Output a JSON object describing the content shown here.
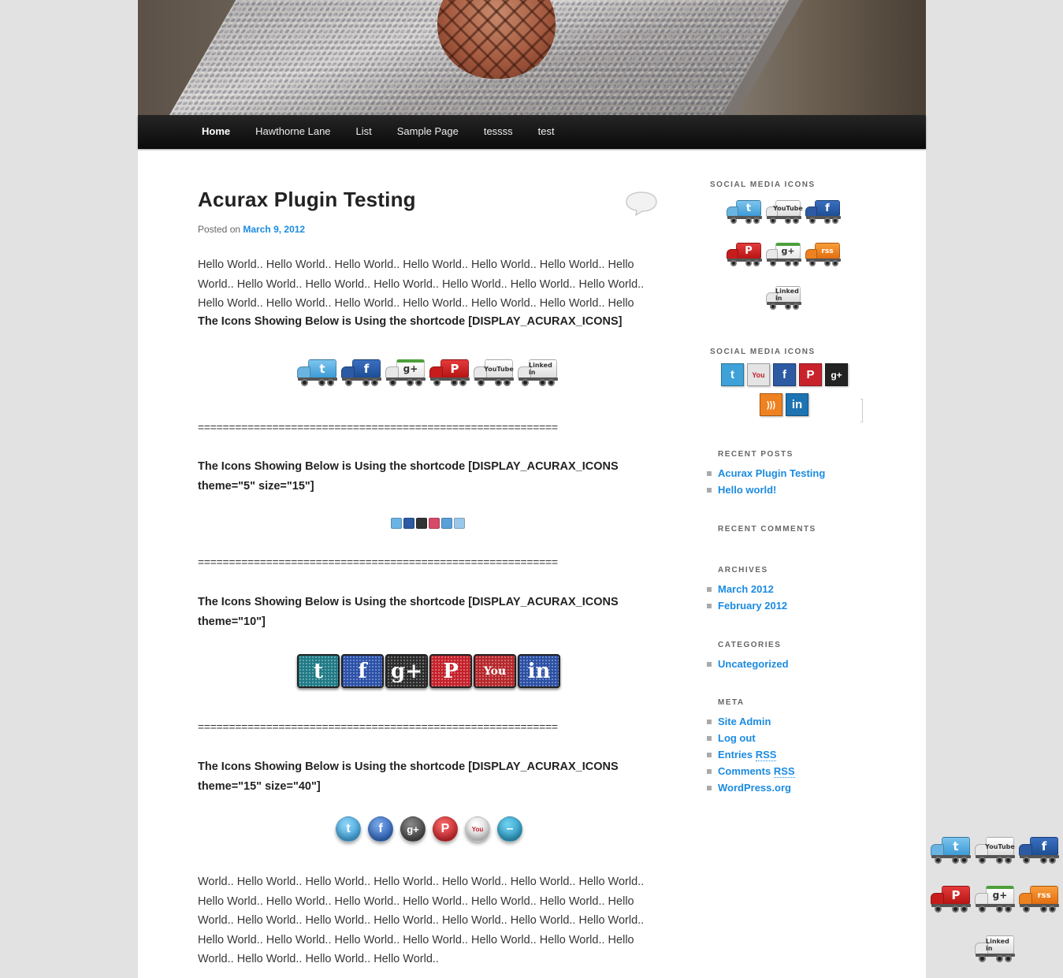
{
  "nav": {
    "items": [
      "Home",
      "Hawthorne Lane",
      "List",
      "Sample Page",
      "tessss",
      "test"
    ]
  },
  "post": {
    "title": "Acurax Plugin Testing",
    "posted_on": "Posted on",
    "date": "March 9, 2012",
    "intro": "Hello World.. Hello World.. Hello World.. Hello World.. Hello World.. Hello World.. Hello World.. Hello World.. Hello World.. Hello World.. Hello World.. Hello World.. Hello World.. Hello World.. Hello World.. Hello World.. Hello World.. Hello World.. Hello World.. Hello",
    "shortcode1": "The Icons Showing Below is Using the shortcode [DISPLAY_ACURAX_ICONS]",
    "separator": "==========================================================",
    "shortcode2_line1": "The Icons Showing Below is Using the shortcode [DISPLAY_ACURAX_ICONS",
    "shortcode2_line2": "theme=\"5\" size=\"15\"]",
    "shortcode3_line1": "The Icons Showing Below is Using the shortcode [DISPLAY_ACURAX_ICONS",
    "shortcode3_line2": "theme=\"10\"]",
    "shortcode4_line1": "The Icons Showing Below is Using the shortcode [DISPLAY_ACURAX_ICONS",
    "shortcode4_line2": "theme=\"15\" size=\"40\"]",
    "outro": "World.. Hello World.. Hello World.. Hello World.. Hello World.. Hello World.. Hello World.. Hello World.. Hello World.. Hello World.. Hello World.. Hello World.. Hello World.. Hello World.. Hello World.. Hello World.. Hello World.. Hello World.. Hello World.. Hello World.. Hello World.. Hello World.. Hello World.. Hello World.. Hello World.. Hello World.. Hello World.. Hello World.. Hello World.. Hello World.."
  },
  "icons": {
    "truck_labels": {
      "twitter": "t",
      "youtube": "YouTube",
      "facebook": "f",
      "gplus": "g+",
      "pinterest": "P",
      "linkedin": "Linked in",
      "rss": "rss"
    }
  },
  "sidebar": {
    "social_title_1": "SOCIAL MEDIA ICONS",
    "social_title_2": "SOCIAL MEDIA ICONS",
    "recent_posts_title": "RECENT POSTS",
    "recent_posts": [
      "Acurax Plugin Testing",
      "Hello world!"
    ],
    "recent_comments_title": "RECENT COMMENTS",
    "archives_title": "ARCHIVES",
    "archives": [
      "March 2012",
      "February 2012"
    ],
    "categories_title": "CATEGORIES",
    "categories": [
      "Uncategorized"
    ],
    "meta_title": "META",
    "meta_site_admin": "Site Admin",
    "meta_log_out": "Log out",
    "meta_entries": "Entries",
    "meta_comments": "Comments",
    "meta_rss": "RSS",
    "meta_wordpress": "WordPress.org"
  },
  "colors": {
    "link": "#1b8be0",
    "nav_bg": "#111111",
    "twitter": "#5ab3e6",
    "facebook": "#2c5aa3",
    "youtube": "#d42b2b",
    "pinterest": "#c8232c",
    "gplus": "#333333",
    "rss": "#ee8220",
    "linkedin": "#1e74b3"
  }
}
